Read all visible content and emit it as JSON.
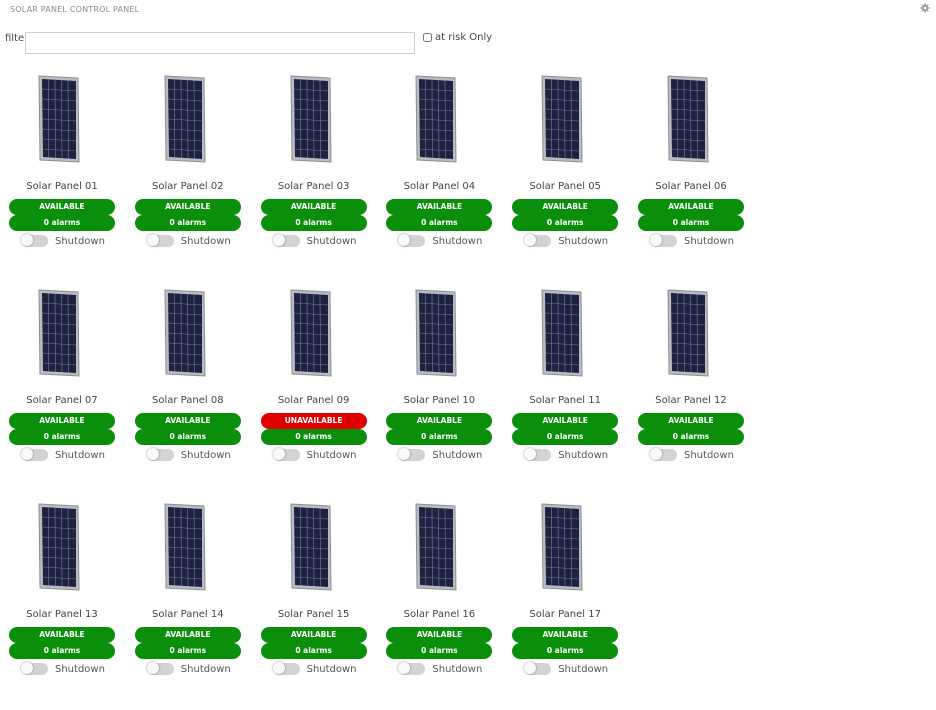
{
  "app": {
    "title": "SOLAR PANEL CONTROL PANEL"
  },
  "filter": {
    "label": "filter",
    "value": "",
    "risk_label": "at risk Only",
    "risk_checked": false
  },
  "colors": {
    "available": "#0a8f0a",
    "unavailable": "#e00000",
    "alarms": "#0a8f0a"
  },
  "panels": [
    {
      "name": "Solar Panel 01",
      "status": "AVAILABLE",
      "alarms": "0 alarms",
      "shutdown_label": "Shutdown",
      "shutdown_on": false
    },
    {
      "name": "Solar Panel 02",
      "status": "AVAILABLE",
      "alarms": "0 alarms",
      "shutdown_label": "Shutdown",
      "shutdown_on": false
    },
    {
      "name": "Solar Panel 03",
      "status": "AVAILABLE",
      "alarms": "0 alarms",
      "shutdown_label": "Shutdown",
      "shutdown_on": false
    },
    {
      "name": "Solar Panel 04",
      "status": "AVAILABLE",
      "alarms": "0 alarms",
      "shutdown_label": "Shutdown",
      "shutdown_on": false
    },
    {
      "name": "Solar Panel 05",
      "status": "AVAILABLE",
      "alarms": "0 alarms",
      "shutdown_label": "Shutdown",
      "shutdown_on": false
    },
    {
      "name": "Solar Panel 06",
      "status": "AVAILABLE",
      "alarms": "0 alarms",
      "shutdown_label": "Shutdown",
      "shutdown_on": false
    },
    {
      "name": "Solar Panel 07",
      "status": "AVAILABLE",
      "alarms": "0 alarms",
      "shutdown_label": "Shutdown",
      "shutdown_on": false
    },
    {
      "name": "Solar Panel 08",
      "status": "AVAILABLE",
      "alarms": "0 alarms",
      "shutdown_label": "Shutdown",
      "shutdown_on": false
    },
    {
      "name": "Solar Panel 09",
      "status": "UNAVAILABLE",
      "alarms": "0 alarms",
      "shutdown_label": "Shutdown",
      "shutdown_on": false
    },
    {
      "name": "Solar Panel 10",
      "status": "AVAILABLE",
      "alarms": "0 alarms",
      "shutdown_label": "Shutdown",
      "shutdown_on": false
    },
    {
      "name": "Solar Panel 11",
      "status": "AVAILABLE",
      "alarms": "0 alarms",
      "shutdown_label": "Shutdown",
      "shutdown_on": false
    },
    {
      "name": "Solar Panel 12",
      "status": "AVAILABLE",
      "alarms": "0 alarms",
      "shutdown_label": "Shutdown",
      "shutdown_on": false
    },
    {
      "name": "Solar Panel 13",
      "status": "AVAILABLE",
      "alarms": "0 alarms",
      "shutdown_label": "Shutdown",
      "shutdown_on": false
    },
    {
      "name": "Solar Panel 14",
      "status": "AVAILABLE",
      "alarms": "0 alarms",
      "shutdown_label": "Shutdown",
      "shutdown_on": false
    },
    {
      "name": "Solar Panel 15",
      "status": "AVAILABLE",
      "alarms": "0 alarms",
      "shutdown_label": "Shutdown",
      "shutdown_on": false
    },
    {
      "name": "Solar Panel 16",
      "status": "AVAILABLE",
      "alarms": "0 alarms",
      "shutdown_label": "Shutdown",
      "shutdown_on": false
    },
    {
      "name": "Solar Panel 17",
      "status": "AVAILABLE",
      "alarms": "0 alarms",
      "shutdown_label": "Shutdown",
      "shutdown_on": false
    }
  ]
}
